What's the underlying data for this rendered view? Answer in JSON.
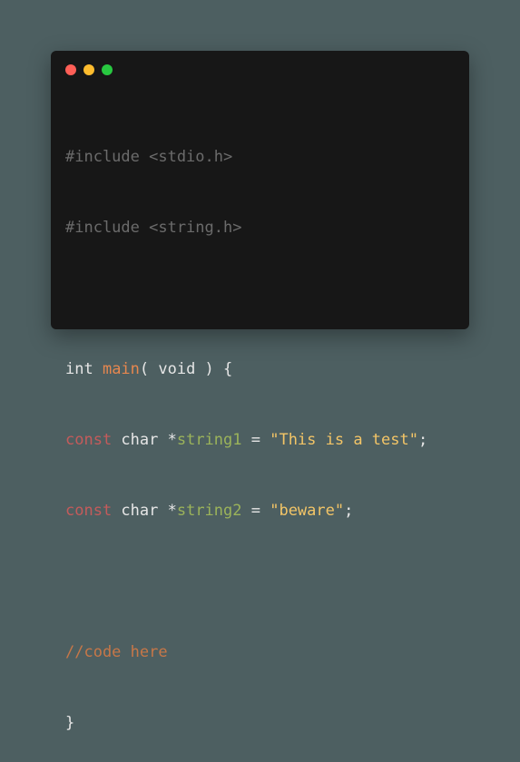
{
  "colors": {
    "background": "#4d5f61",
    "window": "#171717",
    "dot_red": "#ff5f57",
    "dot_yellow": "#febc2e",
    "dot_green": "#28c840",
    "preprocessor": "#6b6b6b",
    "function": "#e6874f",
    "keyword": "#c45b5b",
    "variable": "#9bb35a",
    "string": "#f3c567",
    "comment": "#c77748"
  },
  "code": {
    "line1": "#include <stdio.h>",
    "line2": "#include <string.h>",
    "line4": {
      "int": "int ",
      "fn": "main",
      "rest": "( void ) {"
    },
    "line5": {
      "kw": "const",
      "mid": " char *",
      "var": "string1",
      "eq": " = ",
      "str": "\"This is a test\"",
      "end": ";"
    },
    "line6": {
      "kw": "const",
      "mid": " char *",
      "var": "string2",
      "eq": " = ",
      "str": "\"beware\"",
      "end": ";"
    },
    "line8": "//code here",
    "line9": "}"
  }
}
